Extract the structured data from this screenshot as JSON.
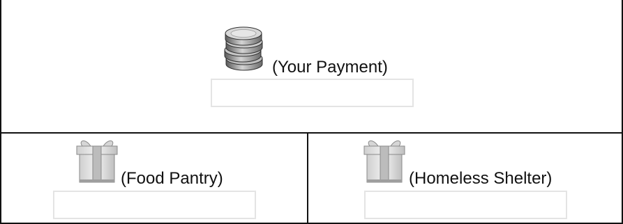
{
  "payment": {
    "icon": "coin-stack-icon",
    "label": "(Your Payment)",
    "value": ""
  },
  "food_pantry": {
    "icon": "gift-box-icon",
    "label": "(Food Pantry)",
    "value": ""
  },
  "homeless_shelter": {
    "icon": "gift-box-icon",
    "label": "(Homeless Shelter)",
    "value": ""
  },
  "colors": {
    "border": "#111111",
    "input_border": "#e4e4e4"
  }
}
